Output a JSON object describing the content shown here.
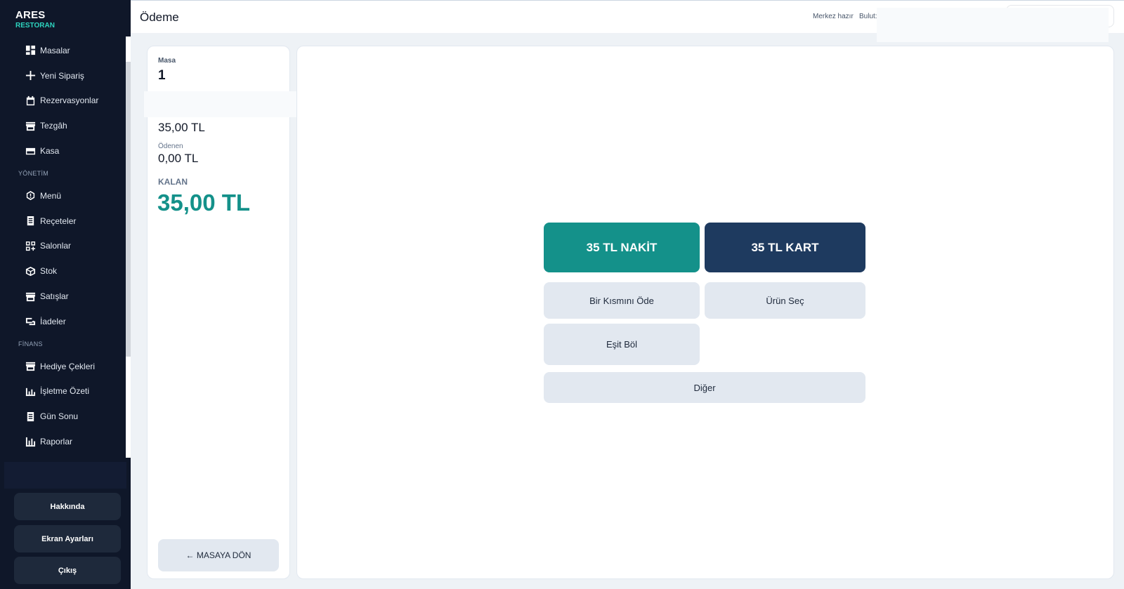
{
  "brand": {
    "name": "ARES",
    "subtitle": "RESTORAN"
  },
  "sidebar": {
    "main_items": [
      {
        "label": "Masalar",
        "icon": "grid-icon"
      },
      {
        "label": "Yeni Sipariş",
        "icon": "plus-icon"
      },
      {
        "label": "Rezervasyonlar",
        "icon": "calendar-icon"
      },
      {
        "label": "Tezgâh",
        "icon": "store-icon"
      },
      {
        "label": "Kasa",
        "icon": "card-icon"
      }
    ],
    "section_management": "YÖNETİM",
    "management_items": [
      {
        "label": "Menü",
        "icon": "hexagon-icon"
      },
      {
        "label": "Reçeteler",
        "icon": "document-icon"
      },
      {
        "label": "Salonlar",
        "icon": "grid-plus-icon"
      },
      {
        "label": "Stok",
        "icon": "box-icon"
      },
      {
        "label": "Satışlar",
        "icon": "store-icon"
      },
      {
        "label": "İadeler",
        "icon": "return-icon"
      }
    ],
    "section_finance": "FİNANS",
    "finance_items": [
      {
        "label": "Hediye Çekleri",
        "icon": "store-icon"
      },
      {
        "label": "İşletme Özeti",
        "icon": "bar-chart-icon"
      },
      {
        "label": "Gün Sonu",
        "icon": "document-icon"
      },
      {
        "label": "Raporlar",
        "icon": "bar-chart-icon"
      }
    ],
    "footer_buttons": {
      "about": "Hakkında",
      "screen_settings": "Ekran Ayarları",
      "logout": "Çıkış"
    }
  },
  "header": {
    "title": "Ödeme",
    "status_center": "Merkez hazır",
    "status_cloud": "Bulut:"
  },
  "summary": {
    "table_label": "Masa",
    "table_value": "1",
    "total_value": "35,00 TL",
    "paid_label": "Ödenen",
    "paid_value": "0,00 TL",
    "remaining_label": "KALAN",
    "remaining_value": "35,00 TL",
    "back_button": "← MASAYA DÖN"
  },
  "payment": {
    "cash_button": "35 TL NAKİT",
    "card_button": "35 TL KART",
    "partial_button": "Bir Kısmını Öde",
    "select_item_button": "Ürün Seç",
    "split_equal_button": "Eşit Böl",
    "other_button": "Diğer"
  },
  "colors": {
    "sidebar_bg": "#0f1729",
    "accent_teal": "#14918a",
    "card_navy": "#1e3a5f",
    "option_bg": "#e2e8f0"
  }
}
